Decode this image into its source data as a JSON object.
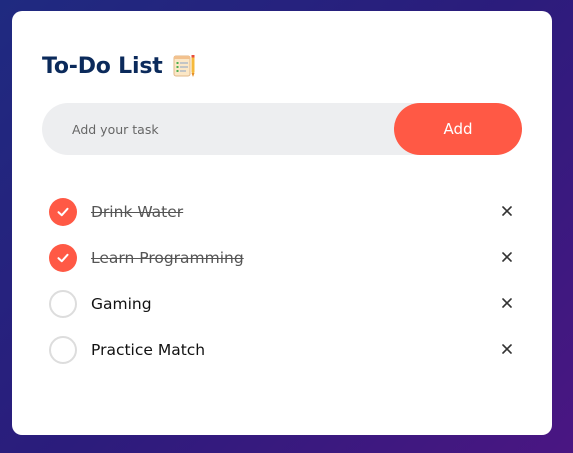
{
  "app": {
    "title": "To-Do List",
    "title_icon": "notepad-checklist-icon",
    "colors": {
      "accent": "#ff5945",
      "title": "#0b2a5b",
      "input_bg": "#edeef0",
      "card_bg": "#ffffff"
    }
  },
  "input": {
    "placeholder": "Add your task",
    "value": ""
  },
  "add_button": {
    "label": "Add"
  },
  "tasks": [
    {
      "label": "Drink Water",
      "checked": true,
      "remove_icon": "close-icon"
    },
    {
      "label": "Learn Programming",
      "checked": true,
      "remove_icon": "close-icon"
    },
    {
      "label": "Gaming",
      "checked": false,
      "remove_icon": "close-icon"
    },
    {
      "label": "Practice Match",
      "checked": false,
      "remove_icon": "close-icon"
    }
  ]
}
